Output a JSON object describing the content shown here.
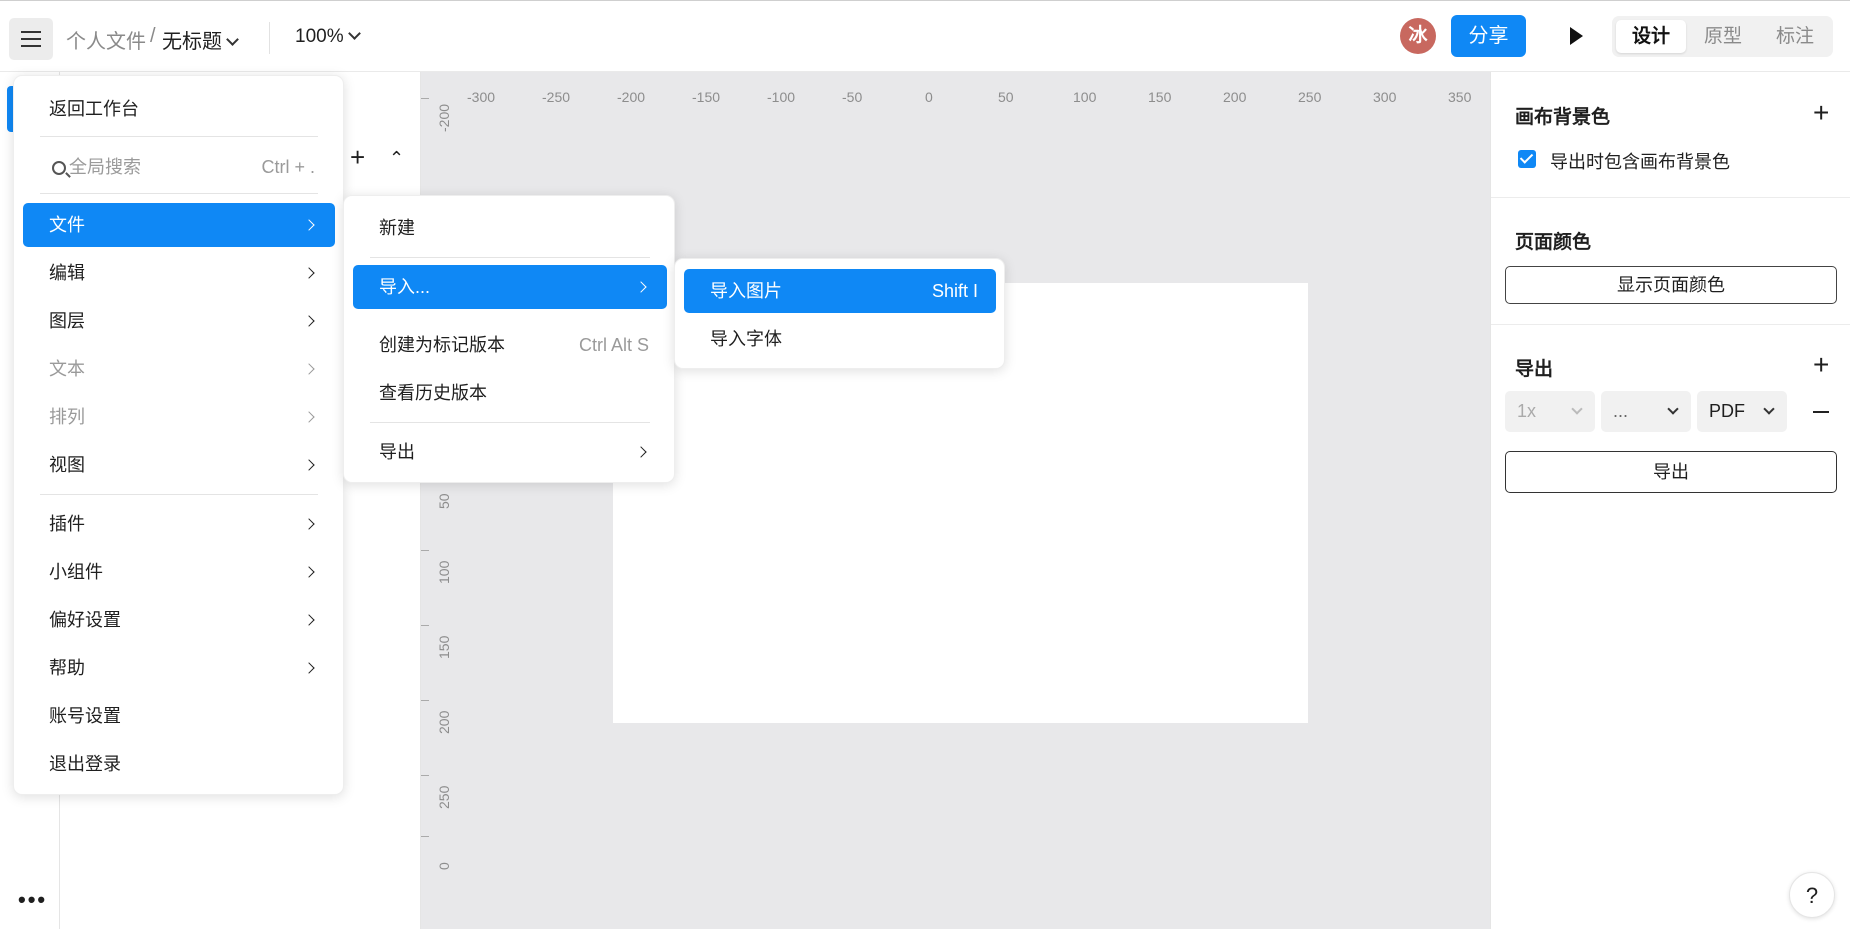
{
  "topbar": {
    "breadcrumb_folder": "个人文件",
    "breadcrumb_sep": "/",
    "file_title": "无标题",
    "zoom": "100%",
    "avatar_letter": "冰",
    "share_label": "分享",
    "modes": [
      "设计",
      "原型",
      "标注"
    ],
    "active_mode": "设计"
  },
  "canvas": {
    "ruler_x": [
      "-300",
      "-250",
      "-200",
      "-150",
      "-100",
      "-50",
      "0",
      "50",
      "100",
      "150",
      "200",
      "250",
      "300",
      "350"
    ],
    "ruler_y": [
      "-200",
      "50",
      "100",
      "150",
      "200",
      "250",
      "0"
    ]
  },
  "right_panel": {
    "canvas_bg_title": "画布背景色",
    "include_bg_label": "导出时包含画布背景色",
    "include_bg_checked": true,
    "page_color_title": "页面颜色",
    "show_page_color_label": "显示页面颜色",
    "export_title": "导出",
    "export_scale": "1x",
    "export_suffix": "...",
    "export_format": "PDF",
    "export_button": "导出"
  },
  "main_menu": {
    "back_to_workspace": "返回工作台",
    "search_placeholder": "全局搜索",
    "search_shortcut": "Ctrl + .",
    "items": [
      {
        "label": "文件",
        "state": "active"
      },
      {
        "label": "编辑",
        "state": "normal"
      },
      {
        "label": "图层",
        "state": "normal"
      },
      {
        "label": "文本",
        "state": "disabled"
      },
      {
        "label": "排列",
        "state": "disabled"
      },
      {
        "label": "视图",
        "state": "normal"
      },
      {
        "label": "插件",
        "state": "normal"
      },
      {
        "label": "小组件",
        "state": "normal"
      },
      {
        "label": "偏好设置",
        "state": "normal"
      },
      {
        "label": "帮助",
        "state": "normal"
      },
      {
        "label": "账号设置",
        "state": "normal"
      },
      {
        "label": "退出登录",
        "state": "normal"
      }
    ]
  },
  "file_menu": {
    "new": "新建",
    "import": "导入...",
    "create_marked_version": "创建为标记版本",
    "create_marked_version_shortcut": "Ctrl Alt S",
    "view_history": "查看历史版本",
    "export": "导出"
  },
  "import_menu": {
    "import_image": "导入图片",
    "import_image_shortcut": "Shift I",
    "import_font": "导入字体"
  },
  "help_label": "?"
}
